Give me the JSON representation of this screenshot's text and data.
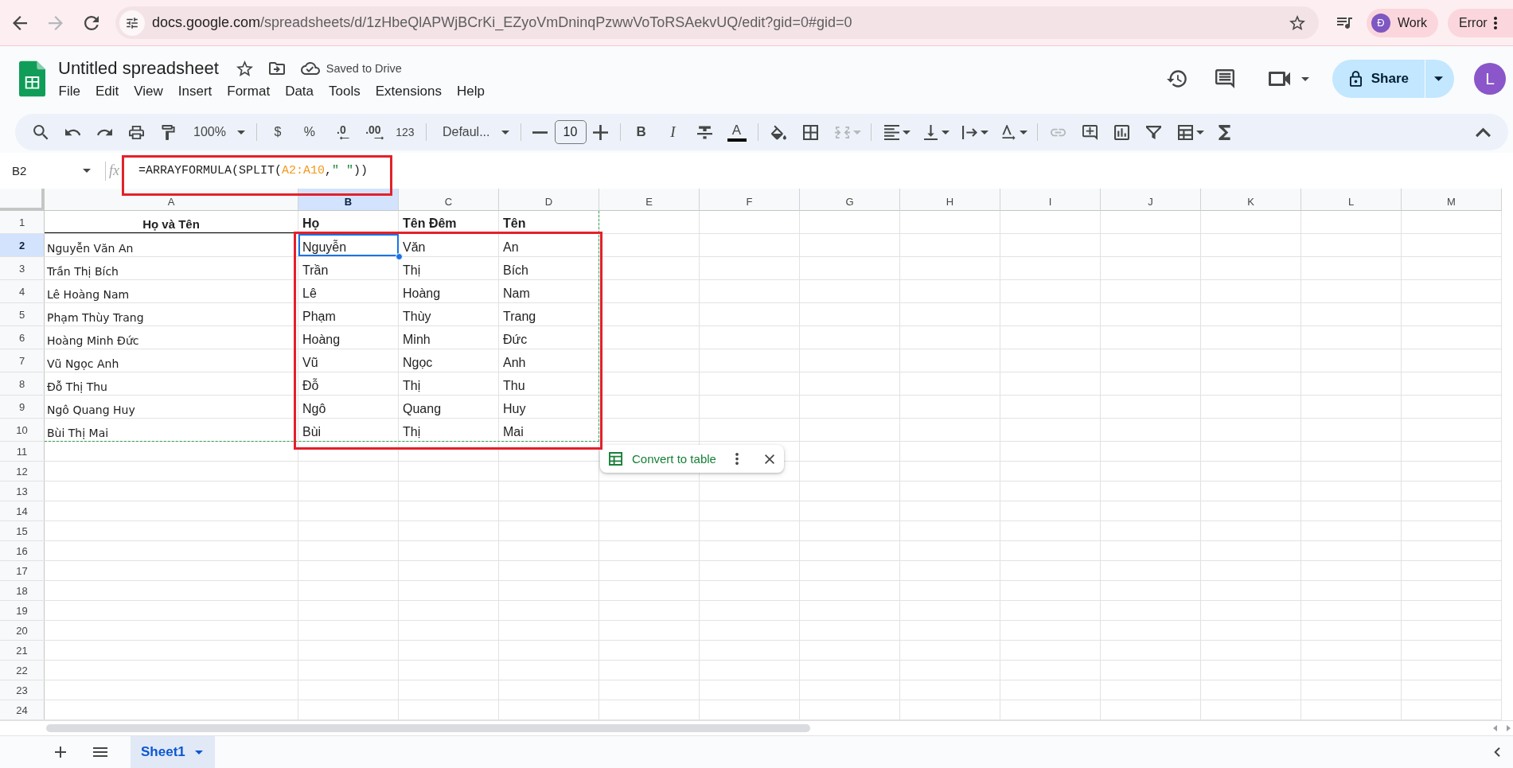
{
  "browser": {
    "back_button": {
      "disabled": false
    },
    "forward_button": {
      "disabled": true
    },
    "url": {
      "host": "docs.google.com",
      "path": "/spreadsheets/d/1zHbeQlAPWjBCrKi_EZyoVmDninqPzwwVoToRSAekvUQ/edit?gid=0#gid=0"
    },
    "profile": {
      "initial": "Đ",
      "label": "Work"
    },
    "error_chip": "Error"
  },
  "document": {
    "title": "Untitled spreadsheet",
    "save_status": "Saved to Drive",
    "menu": [
      "File",
      "Edit",
      "View",
      "Insert",
      "Format",
      "Data",
      "Tools",
      "Extensions",
      "Help"
    ],
    "share_button": "Share",
    "account_initial": "L"
  },
  "toolbar": {
    "zoom": "100%",
    "currency": "$",
    "percent": "%",
    "decrease_decimal": ".0",
    "increase_decimal": ".00",
    "number_format": "123",
    "font": "Defaul...",
    "font_size": "10",
    "bold": "B",
    "italic": "I",
    "text_color": "A",
    "merge_button": {
      "disabled": true
    },
    "link_button": {
      "disabled": true
    }
  },
  "formula_bar": {
    "cell_reference": "B2",
    "fx_label": "fx",
    "formula": [
      {
        "kind": "text",
        "text": "=ARRAYFORMULA(SPLIT("
      },
      {
        "kind": "range",
        "text": "A2:A10"
      },
      {
        "kind": "text",
        "text": ","
      },
      {
        "kind": "string",
        "text": "\" \""
      },
      {
        "kind": "text",
        "text": "))"
      }
    ]
  },
  "sheet": {
    "columns": [
      {
        "label": "A",
        "selected": false
      },
      {
        "label": "B",
        "selected": true
      },
      {
        "label": "C",
        "selected": false
      },
      {
        "label": "D",
        "selected": false
      },
      {
        "label": "E",
        "selected": false
      },
      {
        "label": "F",
        "selected": false
      },
      {
        "label": "G",
        "selected": false
      },
      {
        "label": "H",
        "selected": false
      },
      {
        "label": "I",
        "selected": false
      },
      {
        "label": "J",
        "selected": false
      },
      {
        "label": "K",
        "selected": false
      },
      {
        "label": "L",
        "selected": false
      },
      {
        "label": "M",
        "selected": false
      }
    ],
    "rows": [
      {
        "number": "1",
        "kind": "header",
        "selected": false,
        "cells": [
          "Họ và Tên",
          "Họ",
          "Tên Đêm",
          "Tên"
        ]
      },
      {
        "number": "2",
        "kind": "data",
        "selected": true,
        "cells": [
          "Nguyễn Văn An",
          "Nguyễn",
          "Văn",
          "An"
        ]
      },
      {
        "number": "3",
        "kind": "data",
        "selected": false,
        "cells": [
          "Trần Thị Bích",
          "Trần",
          "Thị",
          "Bích"
        ]
      },
      {
        "number": "4",
        "kind": "data",
        "selected": false,
        "cells": [
          "Lê Hoàng Nam",
          "Lê",
          "Hoàng",
          "Nam"
        ]
      },
      {
        "number": "5",
        "kind": "data",
        "selected": false,
        "cells": [
          "Phạm Thùy Trang",
          "Phạm",
          "Thùy",
          "Trang"
        ]
      },
      {
        "number": "6",
        "kind": "data",
        "selected": false,
        "cells": [
          "Hoàng Minh Đức",
          "Hoàng",
          "Minh",
          "Đức"
        ]
      },
      {
        "number": "7",
        "kind": "data",
        "selected": false,
        "cells": [
          "Vũ Ngọc Anh",
          "Vũ",
          "Ngọc",
          "Anh"
        ]
      },
      {
        "number": "8",
        "kind": "data",
        "selected": false,
        "cells": [
          "Đỗ Thị Thu",
          "Đỗ",
          "Thị",
          "Thu"
        ]
      },
      {
        "number": "9",
        "kind": "data",
        "selected": false,
        "cells": [
          "Ngô Quang Huy",
          "Ngô",
          "Quang",
          "Huy"
        ]
      },
      {
        "number": "10",
        "kind": "data",
        "selected": false,
        "cells": [
          "Bùi Thị Mai",
          "Bùi",
          "Thị",
          "Mai"
        ]
      },
      {
        "number": "11",
        "kind": "empty",
        "selected": false
      },
      {
        "number": "12",
        "kind": "empty",
        "selected": false
      },
      {
        "number": "13",
        "kind": "empty",
        "selected": false
      },
      {
        "number": "14",
        "kind": "empty",
        "selected": false
      },
      {
        "number": "15",
        "kind": "empty",
        "selected": false
      },
      {
        "number": "16",
        "kind": "empty",
        "selected": false
      },
      {
        "number": "17",
        "kind": "empty",
        "selected": false
      },
      {
        "number": "18",
        "kind": "empty",
        "selected": false
      },
      {
        "number": "19",
        "kind": "empty",
        "selected": false
      },
      {
        "number": "20",
        "kind": "empty",
        "selected": false
      },
      {
        "number": "21",
        "kind": "empty",
        "selected": false
      },
      {
        "number": "22",
        "kind": "empty",
        "selected": false
      },
      {
        "number": "23",
        "kind": "empty",
        "selected": false
      },
      {
        "number": "24",
        "kind": "empty",
        "selected": false
      }
    ]
  },
  "table_suggestion": {
    "label": "Convert to table"
  },
  "sheet_tabs": [
    {
      "label": "Sheet1",
      "selected": true
    }
  ]
}
